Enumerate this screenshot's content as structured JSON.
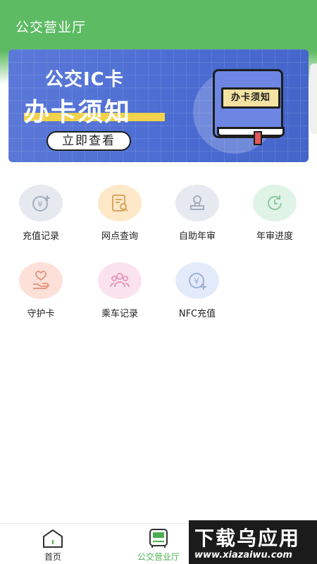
{
  "header": {
    "title": "公交营业厅"
  },
  "banner": {
    "line1": "公交IC卡",
    "line2": "办卡须知",
    "button_label": "立即查看",
    "book_label": "办卡须知"
  },
  "services": [
    {
      "label": "充值记录",
      "icon": "yuan-plus-icon",
      "bg": "#e6e9f0",
      "fg": "#a6aebd"
    },
    {
      "label": "网点查询",
      "icon": "doc-search-icon",
      "bg": "#fde8c8",
      "fg": "#d9a560"
    },
    {
      "label": "自助年审",
      "icon": "stamp-icon",
      "bg": "#e6e9f0",
      "fg": "#a6aebd"
    },
    {
      "label": "年审进度",
      "icon": "clock-refresh-icon",
      "bg": "#dff3e6",
      "fg": "#8fcaa0"
    },
    {
      "label": "守护卡",
      "icon": "heart-hand-icon",
      "bg": "#fde0d8",
      "fg": "#e49a86"
    },
    {
      "label": "乘车记录",
      "icon": "group-icon",
      "bg": "#fbe3ee",
      "fg": "#e39bbd"
    },
    {
      "label": "NFC充值",
      "icon": "yuan-plus-icon",
      "bg": "#e3ebfa",
      "fg": "#9fb1d8"
    }
  ],
  "bottom_nav": {
    "items": [
      {
        "label": "首页",
        "icon": "home-icon",
        "active": false
      },
      {
        "label": "公交营业厅",
        "icon": "bus-icon",
        "active": true
      }
    ]
  },
  "watermark": {
    "top": "下载乌应用",
    "bottom": "www.xiazaiwu.com"
  },
  "colors": {
    "accent": "#4caf50",
    "header_green": "#5dbb63",
    "banner_blue": "#4a6bd2"
  }
}
